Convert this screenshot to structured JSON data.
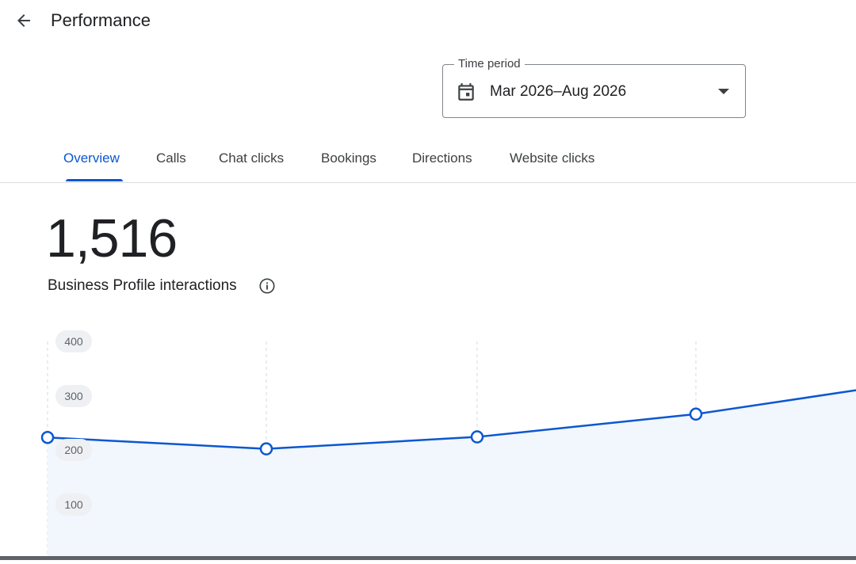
{
  "header": {
    "title": "Performance",
    "back_icon": "arrow-back-icon"
  },
  "time_period": {
    "label": "Time period",
    "value": "Mar 2026–Aug 2026",
    "icon": "calendar-icon",
    "dropdown_icon": "caret-down-icon"
  },
  "tabs": [
    {
      "label": "Overview",
      "active": true
    },
    {
      "label": "Calls",
      "active": false
    },
    {
      "label": "Chat clicks",
      "active": false
    },
    {
      "label": "Bookings",
      "active": false
    },
    {
      "label": "Directions",
      "active": false
    },
    {
      "label": "Website clicks",
      "active": false
    }
  ],
  "metric": {
    "value": "1,516",
    "label": "Business Profile interactions",
    "info_icon": "info-icon"
  },
  "colors": {
    "accent": "#0b57d0",
    "area_fill": "#f2f6fd",
    "grid": "#d5d8dc"
  },
  "chart_data": {
    "type": "line",
    "y_ticks": [
      "400",
      "300",
      "200",
      "100"
    ],
    "ylim": [
      0,
      400
    ],
    "points": [
      {
        "y": 223
      },
      {
        "y": 202
      },
      {
        "y": 224
      },
      {
        "y": 266
      },
      {
        "y": 310
      }
    ],
    "grid": true
  }
}
